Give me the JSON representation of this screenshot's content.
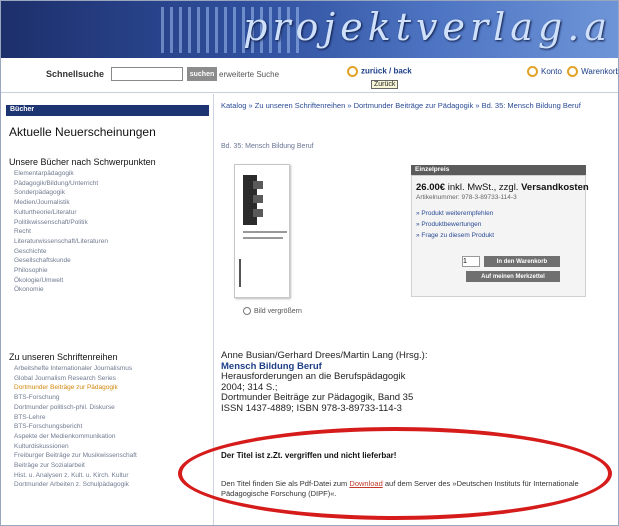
{
  "banner": {
    "logo_text": "projektverlag.a"
  },
  "toolbar": {
    "search_label": "Schnellsuche",
    "search_value": "",
    "search_button": "suchen",
    "advanced_link": "erweiterte Suche",
    "back_label": "zurück / back",
    "back_tooltip": "Zurück",
    "right_links": [
      "Konto",
      "Warenkorb"
    ]
  },
  "sidebar": {
    "tab": "Bücher",
    "heading": "Aktuelle Neuerscheinungen",
    "section1_title": "Unsere Bücher nach Schwerpunkten",
    "section1_items": [
      "Elementarpädagogik",
      "Pädagogik/Bildung/Unterricht",
      "Sonderpädagogik",
      "Medien/Journalistik",
      "Kulturtheorie/Literatur",
      "Politikwissenschaft/Politik",
      "Recht",
      "Literaturwissenschaft/Literaturen",
      "Geschichte",
      "Gesellschaftskunde",
      "Philosophie",
      "Ökologie/Umwelt",
      "Ökonomie"
    ],
    "section2_title": "Zu unseren Schriftenreihen",
    "section2_items": [
      "Arbeitshefte Internationaler Journalismus",
      "Global Journalism Research Series",
      "Dortmunder Beiträge zur Pädagogik",
      "BTS-Forschung",
      "Dortmunder politisch-phil. Diskurse",
      "BTS-Lehre",
      "BTS-Forschungsbericht",
      "Aspekte der Medienkommunikation",
      "Kulturdiskussionen",
      "Freiburger Beiträge zur Musikwissenschaft",
      "Beiträge zur Sozialarbeit",
      "Hist. u. Analysen z. Kult. u. Kirch. Kultur",
      "Dortmunder Arbeiten z. Schulpädagogik"
    ],
    "highlighted_index": 2
  },
  "main": {
    "breadcrumb": "Katalog » Zu unseren Schriftenreihen » Dortmunder Beiträge zur Pädagogik » Bd. 35: Mensch Bildung Beruf",
    "small_title": "Bd. 35: Mensch Bildung Beruf",
    "zoom_label": "Bild vergrößern",
    "price_box": {
      "header": "Einzelpreis",
      "price": "26.00€",
      "price_suffix": "inkl. MwSt., zzgl.",
      "shipping": "Versandkosten",
      "isbn": "Artikelnummer: 978-3-89733-114-3",
      "links": [
        "» Produkt weiterempfehlen",
        "» Produktbewertungen",
        "» Frage zu diesem Produkt"
      ],
      "quantity": "1",
      "cart_button": "In den Warenkorb",
      "wishlist_button": "Auf meinen Merkzettel"
    },
    "bibliography": {
      "authors": "Anne Busian/Gerhard Drees/Martin Lang (Hrsg.):",
      "title": "Mensch Bildung Beruf",
      "subtitle": "Herausforderungen an die Berufspädagogik",
      "year_pages": "2004; 314 S.;",
      "series": "Dortmunder Beiträge zur Pädagogik, Band 35",
      "isbn": "ISSN 1437-4889; ISBN 978-3-89733-114-3"
    },
    "unavailable_notice": "Der Titel ist z.Zt. vergriffen und nicht lieferbar!",
    "pdf_text_before": "Den Titel finden Sie als Pdf-Datei zum",
    "pdf_link": "Download",
    "pdf_text_after": "auf dem Server des »Deutschen Instituts für Internationale Pädagogische Forschung (DIPF)«."
  },
  "colors": {
    "highlight_oval": "#d61b1b",
    "nav_tab": "#1d3473",
    "link": "#2a4b95"
  }
}
